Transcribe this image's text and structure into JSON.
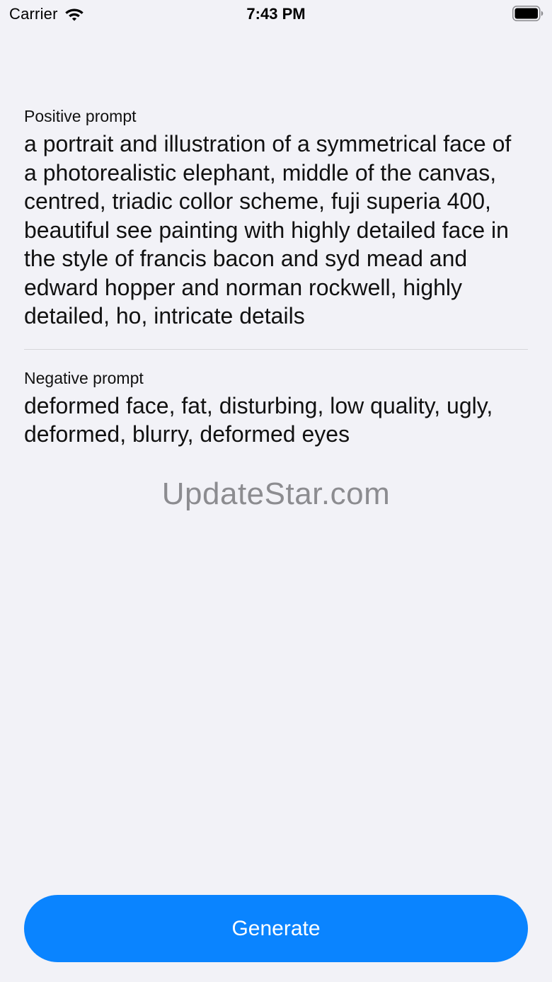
{
  "status_bar": {
    "carrier": "Carrier",
    "time": "7:43 PM",
    "wifi_icon": "wifi-icon",
    "battery_icon": "battery-icon"
  },
  "positive": {
    "label": "Positive prompt",
    "text": "a portrait and illustration of a symmetrical face of a photorealistic elephant, middle of the canvas, centred, triadic collor scheme, fuji superia 400, beautiful see painting with highly detailed face in the style of francis bacon and syd mead and edward hopper and norman rockwell, highly detailed, ho, intricate details"
  },
  "negative": {
    "label": "Negative prompt",
    "text": "deformed face, fat, disturbing, low quality, ugly, deformed, blurry, deformed eyes"
  },
  "watermark": "UpdateStar.com",
  "generate_button": {
    "label": "Generate"
  },
  "colors": {
    "background": "#f2f2f7",
    "accent": "#0a84ff",
    "divider": "#d6d6da",
    "watermark": "#8c8c90"
  }
}
